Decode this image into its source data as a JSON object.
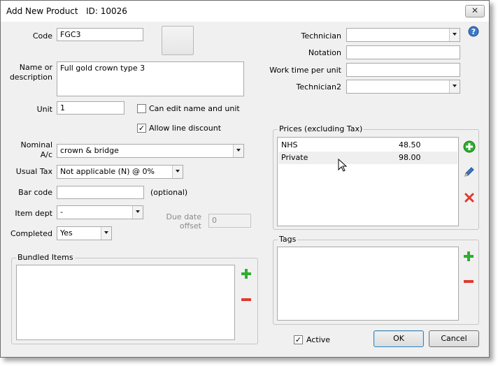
{
  "window": {
    "title": "Add New Product",
    "id_label": "ID: 10026",
    "close_glyph": "✕"
  },
  "left": {
    "code_label": "Code",
    "code_value": "FGC3",
    "name_label_line1": "Name or",
    "name_label_line2": "description",
    "name_value": "Full gold crown type 3",
    "unit_label": "Unit",
    "unit_value": "1",
    "can_edit_label": "Can edit name and unit",
    "allow_discount_label": "Allow line discount",
    "nominal_label_line1": "Nominal",
    "nominal_label_line2": "A/c",
    "nominal_value": "crown & bridge",
    "usual_tax_label": "Usual Tax",
    "usual_tax_value": "Not applicable (N) @ 0%",
    "barcode_label": "Bar code",
    "barcode_value": "",
    "optional_label": "(optional)",
    "item_dept_label": "Item dept",
    "item_dept_value": "-",
    "due_label_line1": "Due date",
    "due_label_line2": "offset",
    "due_value": "0",
    "completed_label": "Completed",
    "completed_value": "Yes",
    "bundled_title": "Bundled Items"
  },
  "right": {
    "technician_label": "Technician",
    "technician_value": "",
    "notation_label": "Notation",
    "notation_value": "",
    "worktime_label": "Work time per unit",
    "worktime_value": "",
    "technician2_label": "Technician2",
    "technician2_value": "",
    "prices_title": "Prices (excluding Tax)",
    "prices": [
      {
        "name": "NHS",
        "price": "48.50"
      },
      {
        "name": "Private",
        "price": "98.00"
      }
    ],
    "tags_title": "Tags"
  },
  "footer": {
    "active_label": "Active",
    "ok_label": "OK",
    "cancel_label": "Cancel"
  },
  "checks": {
    "can_edit": "",
    "allow_discount": "✓",
    "active": "✓"
  },
  "colors": {
    "add_icon": "#2fae2f",
    "remove_icon": "#e03a2e",
    "help_icon": "#3a78c8",
    "edit_icon": "#3a78c8",
    "row_highlight": "#efefef"
  }
}
